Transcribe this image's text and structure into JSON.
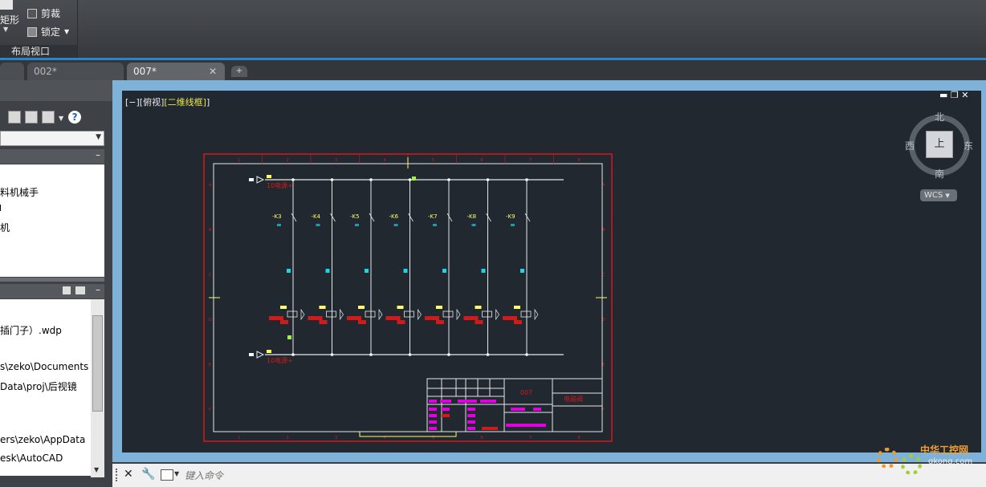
{
  "ribbon": {
    "partial_label": "矩形",
    "clip_label": "剪裁",
    "lock_label": "锁定",
    "panel_title": "布局视口"
  },
  "tabs": [
    {
      "label": "002*"
    },
    {
      "label": "007*"
    }
  ],
  "project_tree": {
    "items": [
      "料机械手",
      "机"
    ]
  },
  "details": {
    "lines": [
      "插门子）.wdp",
      "s\\zeko\\Documents",
      "Data\\proj\\后视镜",
      "ers\\zeko\\AppData",
      "esk\\AutoCAD"
    ]
  },
  "viewport": {
    "label_prefix": "[−][俯视]",
    "label_style": "[二维线框]"
  },
  "viewcube": {
    "north": "北",
    "south": "南",
    "east": "东",
    "west": "西",
    "face": "上",
    "wcs": "WCS"
  },
  "drawing": {
    "relays": [
      "-K3",
      "-K4",
      "-K5",
      "-K6",
      "-K7",
      "-K8",
      "-K9"
    ],
    "top_bus": "10电源+",
    "bottom_bus": "10电源+",
    "title_number": "007",
    "title_name": "电磁阀",
    "col_numbers": [
      "1",
      "2",
      "3",
      "4",
      "5",
      "6",
      "7",
      "8"
    ],
    "row_letters": [
      "A",
      "B",
      "C",
      "D",
      "E",
      "F"
    ]
  },
  "command": {
    "placeholder": "键入命令"
  },
  "watermark": {
    "text": "中华工控网",
    "domain": "gkong.com"
  },
  "colors": {
    "accent": "#2a84c6",
    "frame_red": "#d11a1a",
    "magenta": "#e000e0",
    "yellow": "#ffff66",
    "cyan": "#19d5e6"
  }
}
